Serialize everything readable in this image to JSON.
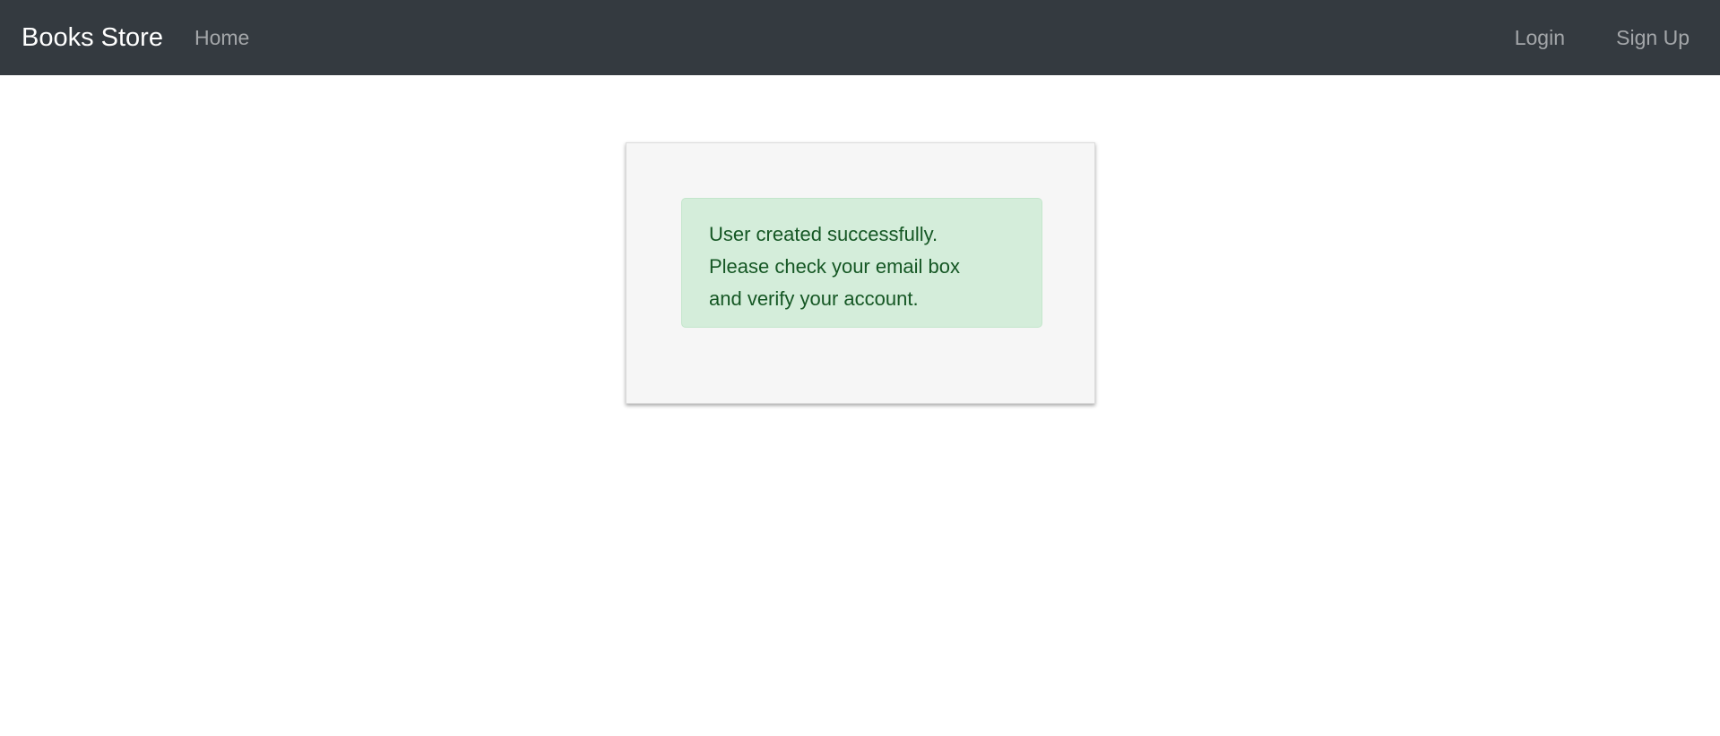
{
  "navbar": {
    "brand": "Books Store",
    "left_links": [
      {
        "label": "Home"
      }
    ],
    "right_links": [
      {
        "label": "Login"
      },
      {
        "label": "Sign Up"
      }
    ],
    "background_color": "#343a40"
  },
  "main": {
    "alert": {
      "type": "success",
      "lines": [
        "User created successfully.",
        "Please check your email box",
        "and verify your account."
      ],
      "background_color": "#d4edda",
      "text_color": "#155724"
    }
  }
}
